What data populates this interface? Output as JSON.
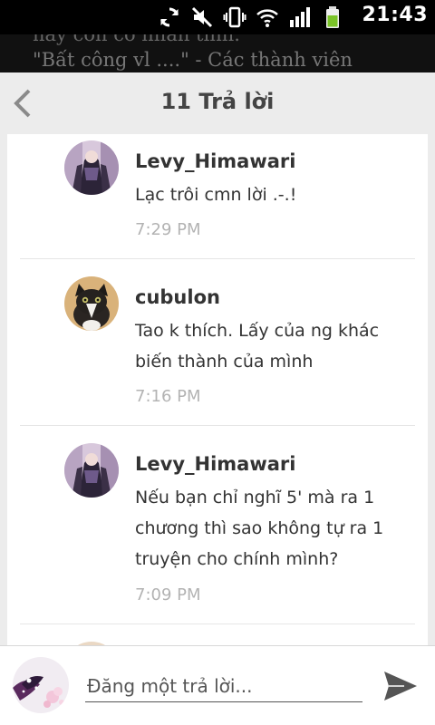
{
  "status_bar": {
    "time": "21:43",
    "icons": [
      "sync-icon",
      "mute-icon",
      "vibrate-icon",
      "wifi-icon",
      "signal-icon",
      "battery-icon"
    ]
  },
  "background_story": {
    "line1": "hay còn có nhân tình.",
    "line2": "\"Bất công vl ....\" - Các thành viên"
  },
  "header": {
    "title": "11 Trả lời",
    "back_icon": "chevron-left-icon"
  },
  "replies": [
    {
      "username": "Levy_Himawari",
      "message": "Lạc trôi cmn lời .-.!",
      "time": "7:29 PM"
    },
    {
      "username": "cubulon",
      "message": "Tao k thích. Lấy của ng khác biến thành của mình",
      "time": "7:16 PM"
    },
    {
      "username": "Levy_Himawari",
      "message": "Nếu bạn chỉ nghĩ 5' mà ra 1 chương thì sao không tự ra 1 truyện cho chính mình?",
      "time": "7:09 PM"
    }
  ],
  "composer": {
    "placeholder": "Đăng một trả lời...",
    "send_icon": "send-icon"
  },
  "colors": {
    "background": "#ececec",
    "card": "#ffffff",
    "text": "#333333",
    "muted": "#b3b3b3"
  }
}
